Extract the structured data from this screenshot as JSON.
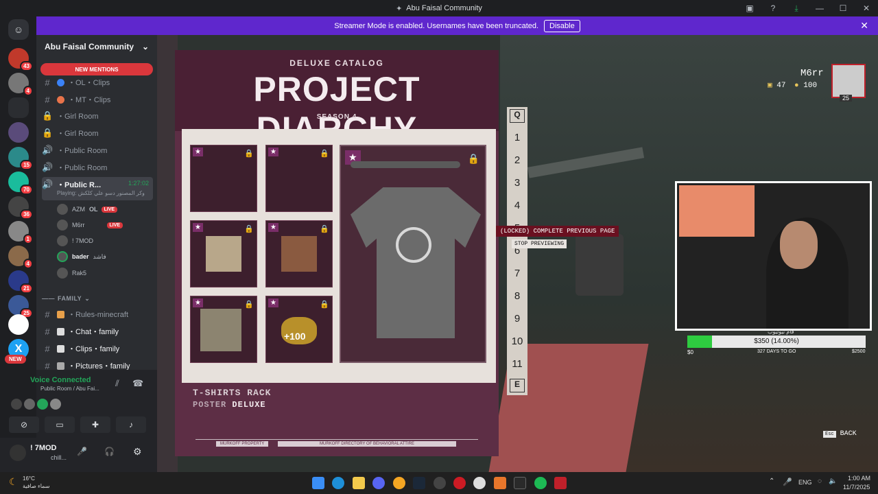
{
  "window": {
    "title": "Abu Faisal Community"
  },
  "banner": {
    "text": "Streamer Mode is enabled. Usernames have been truncated.",
    "disable": "Disable"
  },
  "rail": {
    "badges": [
      "43",
      "4",
      "15",
      "70",
      "36",
      "1",
      "4",
      "21",
      "25"
    ],
    "new_label": "NEW"
  },
  "sidebar": {
    "server_name": "Abu Faisal Community",
    "new_mentions": "NEW MENTIONS",
    "channels": [
      {
        "name": "・OL・Clips"
      },
      {
        "name": "・MT・Clips"
      },
      {
        "name": "・Girl Room"
      },
      {
        "name": "・Girl Room"
      },
      {
        "name": "・Public Room"
      },
      {
        "name": "・Public Room"
      },
      {
        "name": "・Public R...",
        "time": "1:27:02",
        "playing": "Playing: وكر المصنور دسو علي كلكش"
      }
    ],
    "voice_users": [
      {
        "name": "AZM",
        "extra": "OL",
        "live": "LIVE"
      },
      {
        "name": "M6rr",
        "live": "LIVE"
      },
      {
        "name": "! 7MOD"
      },
      {
        "name": "bader",
        "extra": "فاشد"
      },
      {
        "name": "Rak5"
      }
    ],
    "category": "FAMILY",
    "family_channels": [
      {
        "name": "・Rules-minecraft"
      },
      {
        "name": "・Chat・family"
      },
      {
        "name": "・Clips・family"
      },
      {
        "name": "・Pictures・family"
      }
    ]
  },
  "voice": {
    "status": "Voice Connected",
    "location": "Public Room / Abu Fai...",
    "user": "! 7MOD",
    "user_status": "chill..."
  },
  "game": {
    "catalog_label": "DELUXE CATALOG",
    "title": "PROJECT DIARCHY",
    "season": "SEASON 4",
    "item_title": "T-SHIRTS RACK",
    "item_sub1": "POSTER",
    "item_sub2": "DELUXE",
    "footer_left": "MURKOFF PROPERTY",
    "footer_right": "MURKOFF DIRECTORY OF BEHAVIORAL ATTIRE",
    "coin_label": "+100",
    "locked": "(LOCKED) COMPLETE PREVIOUS PAGE",
    "stop": "STOP PREVIEWING",
    "pages": [
      "Q",
      "1",
      "2",
      "3",
      "4",
      "5",
      "6",
      "7",
      "8",
      "9",
      "10",
      "11",
      "E"
    ],
    "player": "M6rr",
    "stat1": "47",
    "stat2": "100",
    "level": "25",
    "back_key": "Esc",
    "back": "BACK",
    "donation": "$350 (14.00%)",
    "donation_min": "$0",
    "donation_days": "327 DAYS TO GO",
    "donation_max": "$2500",
    "donation_progress": 0.14,
    "donation_title": "قام نيوتيوب"
  },
  "taskbar": {
    "weather_temp": "16°C",
    "weather_desc": "سماء صافية",
    "lang": "ENG",
    "time": "1:00 AM",
    "date": "11/7/2025"
  },
  "colors": {
    "accent": "#5f27cd",
    "live": "#da373c",
    "green": "#23a559"
  }
}
